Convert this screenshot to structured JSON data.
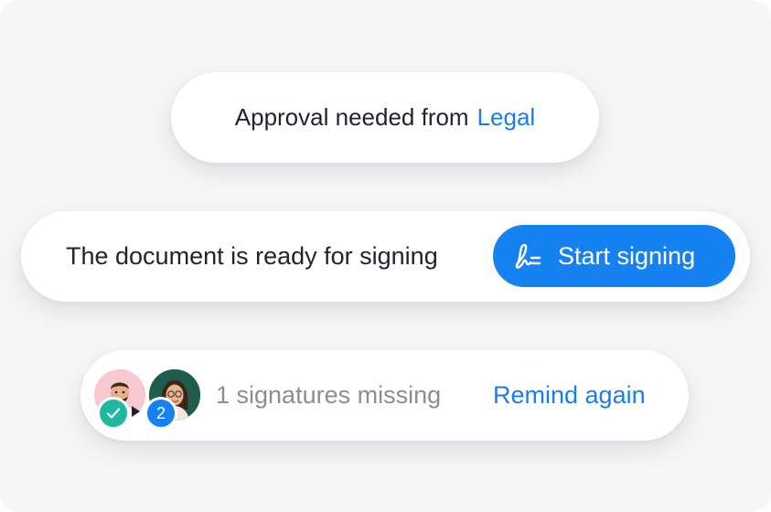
{
  "approval": {
    "text": "Approval needed from",
    "team": "Legal"
  },
  "signing": {
    "status_text": "The document is ready for signing",
    "button_label": "Start signing",
    "button_icon": "signature-icon"
  },
  "signatures": {
    "avatars": [
      {
        "name": "signer-1",
        "status_icon": "check-icon"
      },
      {
        "name": "signer-2",
        "order": "2"
      }
    ],
    "missing_text": "1 signatures missing",
    "remind_label": "Remind again"
  },
  "colors": {
    "accent": "#1681f0",
    "link": "#1a7cf0",
    "success": "#1fb8a0",
    "muted_text": "#8a8d97",
    "background": "#f6f6f7"
  }
}
